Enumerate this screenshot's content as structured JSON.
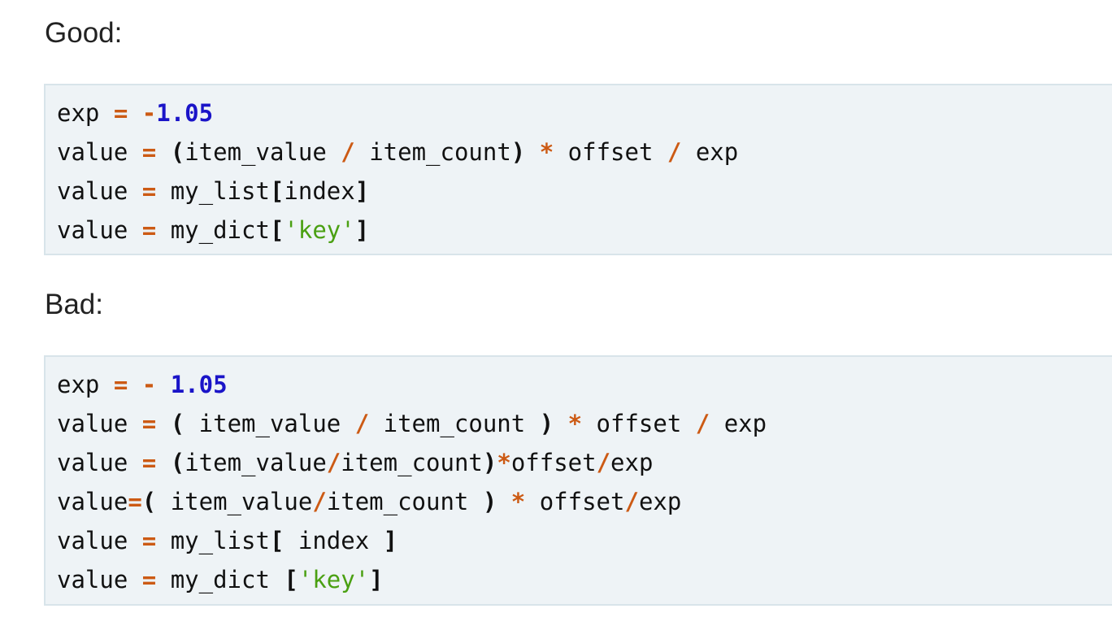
{
  "good": {
    "heading": "Good:",
    "lines": [
      [
        {
          "t": "exp",
          "k": "name"
        },
        {
          "t": " ",
          "k": "name"
        },
        {
          "t": "=",
          "k": "op"
        },
        {
          "t": " ",
          "k": "name"
        },
        {
          "t": "-",
          "k": "op"
        },
        {
          "t": "1.05",
          "k": "num"
        }
      ],
      [
        {
          "t": "value",
          "k": "name"
        },
        {
          "t": " ",
          "k": "name"
        },
        {
          "t": "=",
          "k": "op"
        },
        {
          "t": " ",
          "k": "name"
        },
        {
          "t": "(",
          "k": "punct"
        },
        {
          "t": "item_value",
          "k": "name"
        },
        {
          "t": " ",
          "k": "name"
        },
        {
          "t": "/",
          "k": "op"
        },
        {
          "t": " item_count",
          "k": "name"
        },
        {
          "t": ")",
          "k": "punct"
        },
        {
          "t": " ",
          "k": "name"
        },
        {
          "t": "*",
          "k": "op"
        },
        {
          "t": " offset ",
          "k": "name"
        },
        {
          "t": "/",
          "k": "op"
        },
        {
          "t": " exp",
          "k": "name"
        }
      ],
      [
        {
          "t": "value",
          "k": "name"
        },
        {
          "t": " ",
          "k": "name"
        },
        {
          "t": "=",
          "k": "op"
        },
        {
          "t": " my_list",
          "k": "name"
        },
        {
          "t": "[",
          "k": "punct"
        },
        {
          "t": "index",
          "k": "name"
        },
        {
          "t": "]",
          "k": "punct"
        }
      ],
      [
        {
          "t": "value",
          "k": "name"
        },
        {
          "t": " ",
          "k": "name"
        },
        {
          "t": "=",
          "k": "op"
        },
        {
          "t": " my_dict",
          "k": "name"
        },
        {
          "t": "[",
          "k": "punct"
        },
        {
          "t": "'key'",
          "k": "str"
        },
        {
          "t": "]",
          "k": "punct"
        }
      ]
    ]
  },
  "bad": {
    "heading": "Bad:",
    "lines": [
      [
        {
          "t": "exp",
          "k": "name"
        },
        {
          "t": " ",
          "k": "name"
        },
        {
          "t": "=",
          "k": "op"
        },
        {
          "t": " ",
          "k": "name"
        },
        {
          "t": "-",
          "k": "op"
        },
        {
          "t": " ",
          "k": "name"
        },
        {
          "t": "1.05",
          "k": "num"
        }
      ],
      [
        {
          "t": "value",
          "k": "name"
        },
        {
          "t": " ",
          "k": "name"
        },
        {
          "t": "=",
          "k": "op"
        },
        {
          "t": " ",
          "k": "name"
        },
        {
          "t": "(",
          "k": "punct"
        },
        {
          "t": " item_value ",
          "k": "name"
        },
        {
          "t": "/",
          "k": "op"
        },
        {
          "t": " item_count ",
          "k": "name"
        },
        {
          "t": ")",
          "k": "punct"
        },
        {
          "t": " ",
          "k": "name"
        },
        {
          "t": "*",
          "k": "op"
        },
        {
          "t": " offset ",
          "k": "name"
        },
        {
          "t": "/",
          "k": "op"
        },
        {
          "t": " exp",
          "k": "name"
        }
      ],
      [
        {
          "t": "value",
          "k": "name"
        },
        {
          "t": " ",
          "k": "name"
        },
        {
          "t": "=",
          "k": "op"
        },
        {
          "t": " ",
          "k": "name"
        },
        {
          "t": "(",
          "k": "punct"
        },
        {
          "t": "item_value",
          "k": "name"
        },
        {
          "t": "/",
          "k": "op"
        },
        {
          "t": "item_count",
          "k": "name"
        },
        {
          "t": ")",
          "k": "punct"
        },
        {
          "t": "*",
          "k": "op"
        },
        {
          "t": "offset",
          "k": "name"
        },
        {
          "t": "/",
          "k": "op"
        },
        {
          "t": "exp",
          "k": "name"
        }
      ],
      [
        {
          "t": "value",
          "k": "name"
        },
        {
          "t": "=",
          "k": "op"
        },
        {
          "t": "(",
          "k": "punct"
        },
        {
          "t": " item_value",
          "k": "name"
        },
        {
          "t": "/",
          "k": "op"
        },
        {
          "t": "item_count ",
          "k": "name"
        },
        {
          "t": ")",
          "k": "punct"
        },
        {
          "t": " ",
          "k": "name"
        },
        {
          "t": "*",
          "k": "op"
        },
        {
          "t": " offset",
          "k": "name"
        },
        {
          "t": "/",
          "k": "op"
        },
        {
          "t": "exp",
          "k": "name"
        }
      ],
      [
        {
          "t": "value",
          "k": "name"
        },
        {
          "t": " ",
          "k": "name"
        },
        {
          "t": "=",
          "k": "op"
        },
        {
          "t": " my_list",
          "k": "name"
        },
        {
          "t": "[",
          "k": "punct"
        },
        {
          "t": " index ",
          "k": "name"
        },
        {
          "t": "]",
          "k": "punct"
        }
      ],
      [
        {
          "t": "value",
          "k": "name"
        },
        {
          "t": " ",
          "k": "name"
        },
        {
          "t": "=",
          "k": "op"
        },
        {
          "t": " my_dict ",
          "k": "name"
        },
        {
          "t": "[",
          "k": "punct"
        },
        {
          "t": "'key'",
          "k": "str"
        },
        {
          "t": "]",
          "k": "punct"
        }
      ]
    ]
  }
}
